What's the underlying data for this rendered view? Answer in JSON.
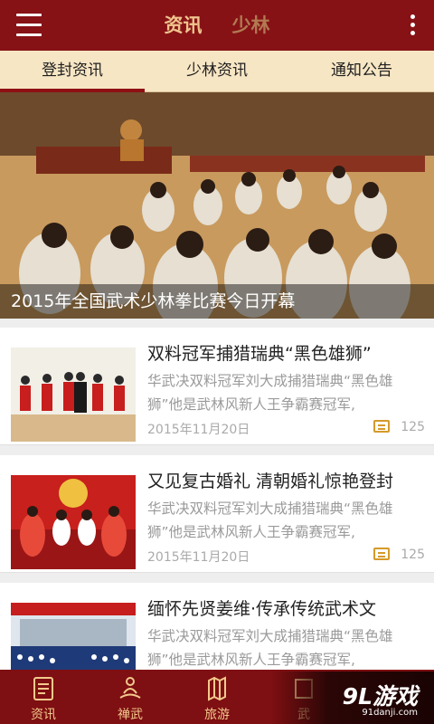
{
  "header": {
    "tabs": [
      {
        "label": "资讯",
        "active": true
      },
      {
        "label": "少林",
        "active": false
      }
    ],
    "menu_icon": "hamburger-icon",
    "more_icon": "more-vertical-icon"
  },
  "categories": [
    {
      "label": "登封资讯",
      "active": true
    },
    {
      "label": "少林资讯",
      "active": false
    },
    {
      "label": "通知公告",
      "active": false
    }
  ],
  "banner": {
    "caption": "2015年全国武术少林拳比赛今日开幕"
  },
  "news": [
    {
      "title": "双料冠军捕猎瑞典“黑色雄狮”",
      "desc": "华武决双料冠军刘大成捕猎瑞典“黑色雄狮”他是武林风新人王争霸赛冠军,",
      "date": "2015年11月20日",
      "comments": "125"
    },
    {
      "title": "又见复古婚礼 清朝婚礼惊艳登封",
      "desc": "华武决双料冠军刘大成捕猎瑞典“黑色雄狮”他是武林风新人王争霸赛冠军,",
      "date": "2015年11月20日",
      "comments": "125"
    },
    {
      "title": "缅怀先贤姜维·传承传统武术文",
      "desc": "华武决双料冠军刘大成捕猎瑞典“黑色雄狮”他是武林风新人王争霸赛冠军,",
      "date": "",
      "comments": ""
    }
  ],
  "bottom_nav": [
    {
      "label": "资讯",
      "icon": "document-icon"
    },
    {
      "label": "禅武",
      "icon": "meditation-icon"
    },
    {
      "label": "旅游",
      "icon": "map-icon"
    },
    {
      "label": "武",
      "icon": "zen-icon"
    }
  ],
  "watermark": {
    "text": "9L游戏",
    "sub": "91danji.com"
  },
  "colors": {
    "primary": "#861216",
    "accent": "#f0c48d",
    "tab_bg": "#f7e6c4"
  }
}
